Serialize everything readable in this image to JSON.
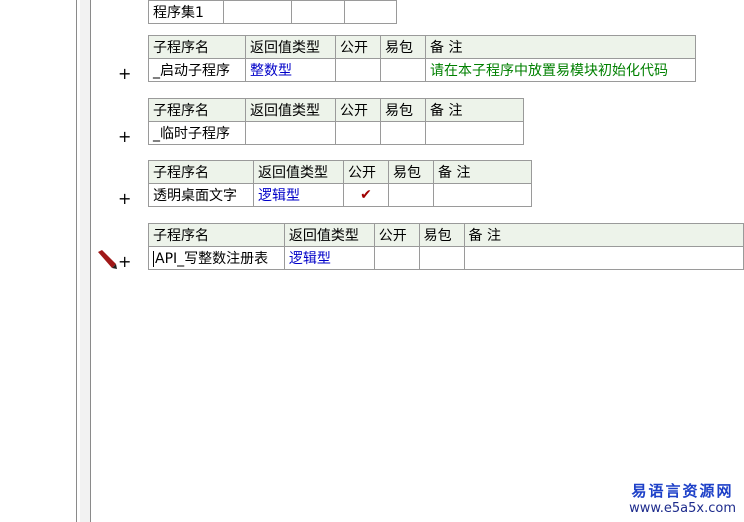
{
  "header_cols": {
    "name": "子程序名",
    "ret": "返回值类型",
    "public": "公开",
    "easy": "易包",
    "note": "备 注"
  },
  "assembly": {
    "label": "程序集1"
  },
  "plus_symbol": "+",
  "check_symbol": "✔",
  "rows": [
    {
      "name": "_启动子程序",
      "ret": "整数型",
      "public": "",
      "easy": "",
      "note": "请在本子程序中放置易模块初始化代码"
    },
    {
      "name": "_临时子程序",
      "ret": "",
      "public": "",
      "easy": "",
      "note": ""
    },
    {
      "name": "透明桌面文字",
      "ret": "逻辑型",
      "public": "✔",
      "easy": "",
      "note": ""
    },
    {
      "name": "API_写整数注册表",
      "ret": "逻辑型",
      "public": "",
      "easy": "",
      "note": ""
    }
  ],
  "watermark": {
    "line1": "易语言资源网",
    "line2": "www.e5a5x.com"
  },
  "colors": {
    "header_bg": "#edf3ea",
    "type_text": "#0000c8",
    "note_text": "#008000",
    "check": "#a00000"
  }
}
